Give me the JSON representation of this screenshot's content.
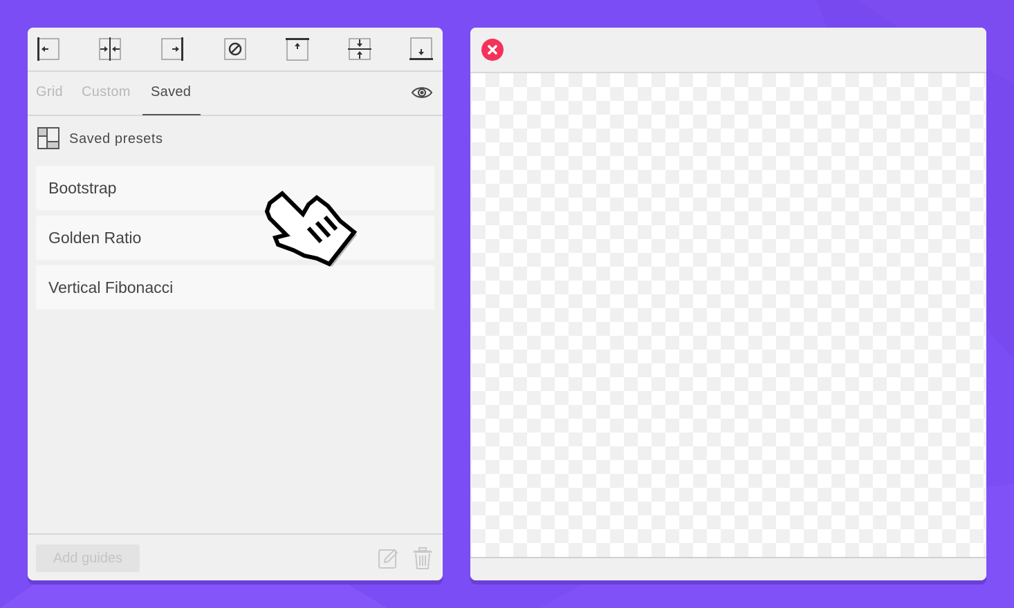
{
  "toolbar": {
    "tools": [
      {
        "icon": "align-left-guide-icon"
      },
      {
        "icon": "align-center-vertical-guide-icon"
      },
      {
        "icon": "align-right-guide-icon"
      },
      {
        "icon": "clear-guides-icon"
      },
      {
        "icon": "align-top-guide-icon"
      },
      {
        "icon": "align-middle-horizontal-guide-icon"
      },
      {
        "icon": "align-bottom-guide-icon"
      }
    ]
  },
  "tabs": [
    {
      "label": "Grid",
      "active": false
    },
    {
      "label": "Custom",
      "active": false
    },
    {
      "label": "Saved",
      "active": true
    }
  ],
  "visibility_icon": "eye-icon",
  "saved": {
    "section_title": "Saved presets",
    "section_icon": "layout-icon",
    "presets": [
      "Bootstrap",
      "Golden Ratio",
      "Vertical Fibonacci"
    ]
  },
  "footer": {
    "add_label": "Add guides",
    "edit_icon": "edit-icon",
    "delete_icon": "trash-icon"
  },
  "preview": {
    "close_icon": "close-icon"
  },
  "colors": {
    "background": "#7b4df5",
    "panel": "#f0f0f0",
    "close": "#f4325a",
    "active_tab": "#4a4a4a",
    "inactive_tab": "#b8b8b8"
  }
}
